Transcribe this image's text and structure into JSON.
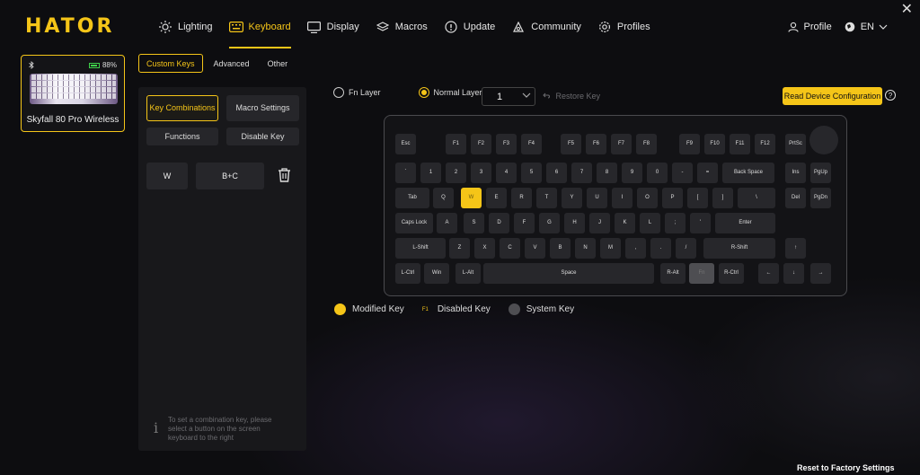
{
  "app": {
    "logo": "HATOR",
    "close_glyph": "✕"
  },
  "nav": [
    {
      "label": "Lighting",
      "icon": "sun-icon"
    },
    {
      "label": "Keyboard",
      "icon": "keyboard-icon",
      "active": true
    },
    {
      "label": "Display",
      "icon": "monitor-icon"
    },
    {
      "label": "Macros",
      "icon": "layers-icon"
    },
    {
      "label": "Update",
      "icon": "update-icon"
    },
    {
      "label": "Community",
      "icon": "community-icon"
    },
    {
      "label": "Profiles",
      "icon": "gear-icon"
    }
  ],
  "right_nav": {
    "profile": "Profile",
    "language": "EN"
  },
  "device": {
    "name": "Skyfall 80 Pro Wireless",
    "battery": "88%",
    "battery_level": 0.88
  },
  "subtabs": [
    "Custom Keys",
    "Advanced",
    "Other"
  ],
  "left_panel": {
    "btn_key_combinations": "Key Combinations",
    "btn_macro_settings": "Macro Settings",
    "btn_functions": "Functions",
    "btn_disable_key": "Disable Key",
    "combo_from": "W",
    "combo_to": "B+C",
    "hint": "To set a combination key, please select a button on the screen keyboard to the right"
  },
  "layers": {
    "fn_layer": "Fn Layer",
    "normal_layer": "Normal Layer",
    "selected_value": "1",
    "restore_key": "Restore Key",
    "read_config": "Read Device Configuration",
    "help": "?"
  },
  "keys": {
    "row0": [
      "Esc",
      "F1",
      "F2",
      "F3",
      "F4",
      "F5",
      "F6",
      "F7",
      "F8",
      "F9",
      "F10",
      "F11",
      "F12",
      "PrtSc"
    ],
    "row1": [
      "`",
      "1",
      "2",
      "3",
      "4",
      "5",
      "6",
      "7",
      "8",
      "9",
      "0",
      "-",
      "=",
      "Back Space",
      "Ins",
      "PgUp"
    ],
    "row2": [
      "Tab",
      "Q",
      "W",
      "E",
      "R",
      "T",
      "Y",
      "U",
      "I",
      "O",
      "P",
      "[",
      "]",
      "\\",
      "Del",
      "PgDn"
    ],
    "row3": [
      "Caps Lock",
      "A",
      "S",
      "D",
      "F",
      "G",
      "H",
      "J",
      "K",
      "L",
      ";",
      "'",
      "Enter"
    ],
    "row4": [
      "L-Shift",
      "Z",
      "X",
      "C",
      "V",
      "B",
      "N",
      "M",
      ",",
      ".",
      "/",
      "R-Shift",
      "↑"
    ],
    "row5": [
      "L-Ctrl",
      "Win",
      "L-Alt",
      "Space",
      "R-Alt",
      "Fn",
      "R-Ctrl",
      "←",
      "↓",
      "→"
    ]
  },
  "legend": {
    "modified": "Modified Key",
    "disabled_tag": "F1",
    "disabled": "Disabled Key",
    "system": "System Key"
  },
  "colors": {
    "accent": "#f5c518",
    "system_key": "#4e4e52",
    "key": "#27272b"
  },
  "footer": {
    "reset": "Reset to Factory Settings"
  }
}
